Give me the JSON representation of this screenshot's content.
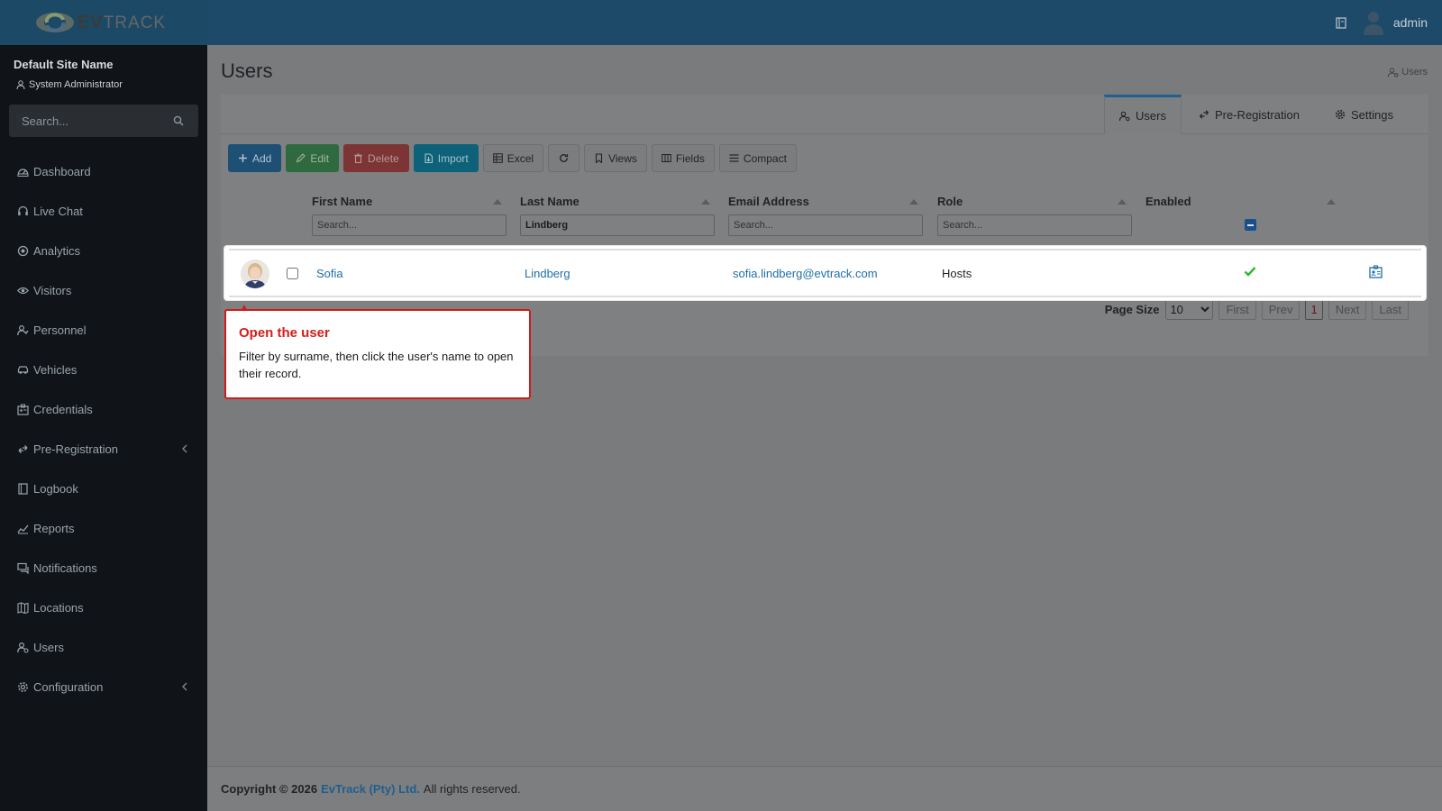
{
  "app": {
    "brand_ev": "EV",
    "brand_track": "TRACK",
    "user_name": "admin"
  },
  "sidebar": {
    "site_name": "Default Site Name",
    "role": "System Administrator",
    "search_placeholder": "Search...",
    "items": [
      {
        "label": "Dashboard",
        "icon": "dashboard-icon"
      },
      {
        "label": "Live Chat",
        "icon": "headset-icon"
      },
      {
        "label": "Analytics",
        "icon": "analytics-icon"
      },
      {
        "label": "Visitors",
        "icon": "eye-icon"
      },
      {
        "label": "Personnel",
        "icon": "personnel-icon"
      },
      {
        "label": "Vehicles",
        "icon": "car-icon"
      },
      {
        "label": "Credentials",
        "icon": "id-card-icon"
      },
      {
        "label": "Pre-Registration",
        "icon": "exchange-icon",
        "expandable": true
      },
      {
        "label": "Logbook",
        "icon": "book-icon"
      },
      {
        "label": "Reports",
        "icon": "reports-icon"
      },
      {
        "label": "Notifications",
        "icon": "chat-icon"
      },
      {
        "label": "Locations",
        "icon": "map-icon"
      },
      {
        "label": "Users",
        "icon": "users-icon"
      },
      {
        "label": "Configuration",
        "icon": "gear-icon",
        "expandable": true
      }
    ]
  },
  "page": {
    "title": "Users",
    "breadcrumb": "Users"
  },
  "tabs": [
    {
      "label": "Users",
      "active": true
    },
    {
      "label": "Pre-Registration",
      "active": false
    },
    {
      "label": "Settings",
      "active": false
    }
  ],
  "toolbar": {
    "add": "Add",
    "edit": "Edit",
    "delete": "Delete",
    "import": "Import",
    "excel": "Excel",
    "views": "Views",
    "fields": "Fields",
    "compact": "Compact"
  },
  "table": {
    "columns": [
      "First Name",
      "Last Name",
      "Email Address",
      "Role",
      "Enabled"
    ],
    "filters": {
      "first_name": {
        "value": "",
        "placeholder": "Search..."
      },
      "last_name": {
        "value": "Lindberg",
        "placeholder": "Search..."
      },
      "email": {
        "value": "",
        "placeholder": "Search..."
      },
      "role": {
        "value": "",
        "placeholder": "Search..."
      }
    },
    "rows": [
      {
        "first_name": "Sofia",
        "last_name": "Lindberg",
        "email": "sofia.lindberg@evtrack.com",
        "role": "Hosts",
        "enabled": true
      }
    ]
  },
  "pager": {
    "label": "Page Size",
    "size": "10",
    "first": "First",
    "prev": "Prev",
    "current": "1",
    "next": "Next",
    "last": "Last"
  },
  "tooltip": {
    "title": "Open the user",
    "body": "Filter by surname, then click the user's name to open their record."
  },
  "footer": {
    "copyright": "Copyright © 2026",
    "company": "EvTrack (Pty) Ltd.",
    "rights": "All rights reserved."
  },
  "colors": {
    "topbar": "#1d4a68",
    "sidebar": "#101418",
    "accent": "#1f6fa8",
    "tooltip_border": "#d21a1a"
  }
}
